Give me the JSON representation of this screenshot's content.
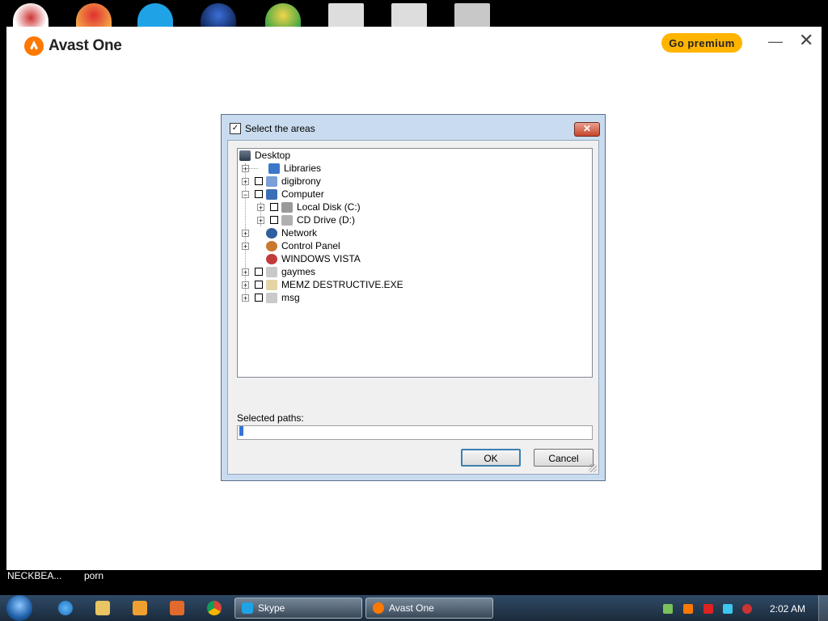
{
  "desktop": {
    "labels": [
      "NECKBEA...",
      "porn"
    ]
  },
  "avast": {
    "title": "Avast One",
    "go_premium": "Go premium",
    "minimize": "—",
    "close": "✕",
    "brand_color": "#ff7800",
    "premium_color": "#ffb400"
  },
  "dialog": {
    "title": "Select the areas",
    "close": "✕",
    "tree": [
      {
        "label": "Desktop",
        "icon": "desktop-icon"
      },
      {
        "label": "Libraries",
        "icon": "libraries-icon"
      },
      {
        "label": "digibrony",
        "icon": "user-folder-icon"
      },
      {
        "label": "Computer",
        "icon": "computer-icon"
      },
      {
        "label": "Local Disk (C:)",
        "icon": "disk-icon"
      },
      {
        "label": "CD Drive (D:)",
        "icon": "cd-drive-icon"
      },
      {
        "label": "Network",
        "icon": "network-icon"
      },
      {
        "label": "Control Panel",
        "icon": "control-panel-icon"
      },
      {
        "label": "WINDOWS VISTA",
        "icon": "vista-icon"
      },
      {
        "label": "gaymes",
        "icon": "folder-icon"
      },
      {
        "label": "MEMZ DESTRUCTIVE.EXE",
        "icon": "file-icon"
      },
      {
        "label": "msg",
        "icon": "folder-icon"
      }
    ],
    "selected_paths_label": "Selected paths:",
    "selected_paths_value": "",
    "ok": "OK",
    "cancel": "Cancel"
  },
  "taskbar": {
    "buttons": [
      {
        "label": "Skype",
        "icon": "skype-icon"
      },
      {
        "label": "Avast One",
        "icon": "avast-icon"
      }
    ],
    "clock": "2:02 AM"
  }
}
